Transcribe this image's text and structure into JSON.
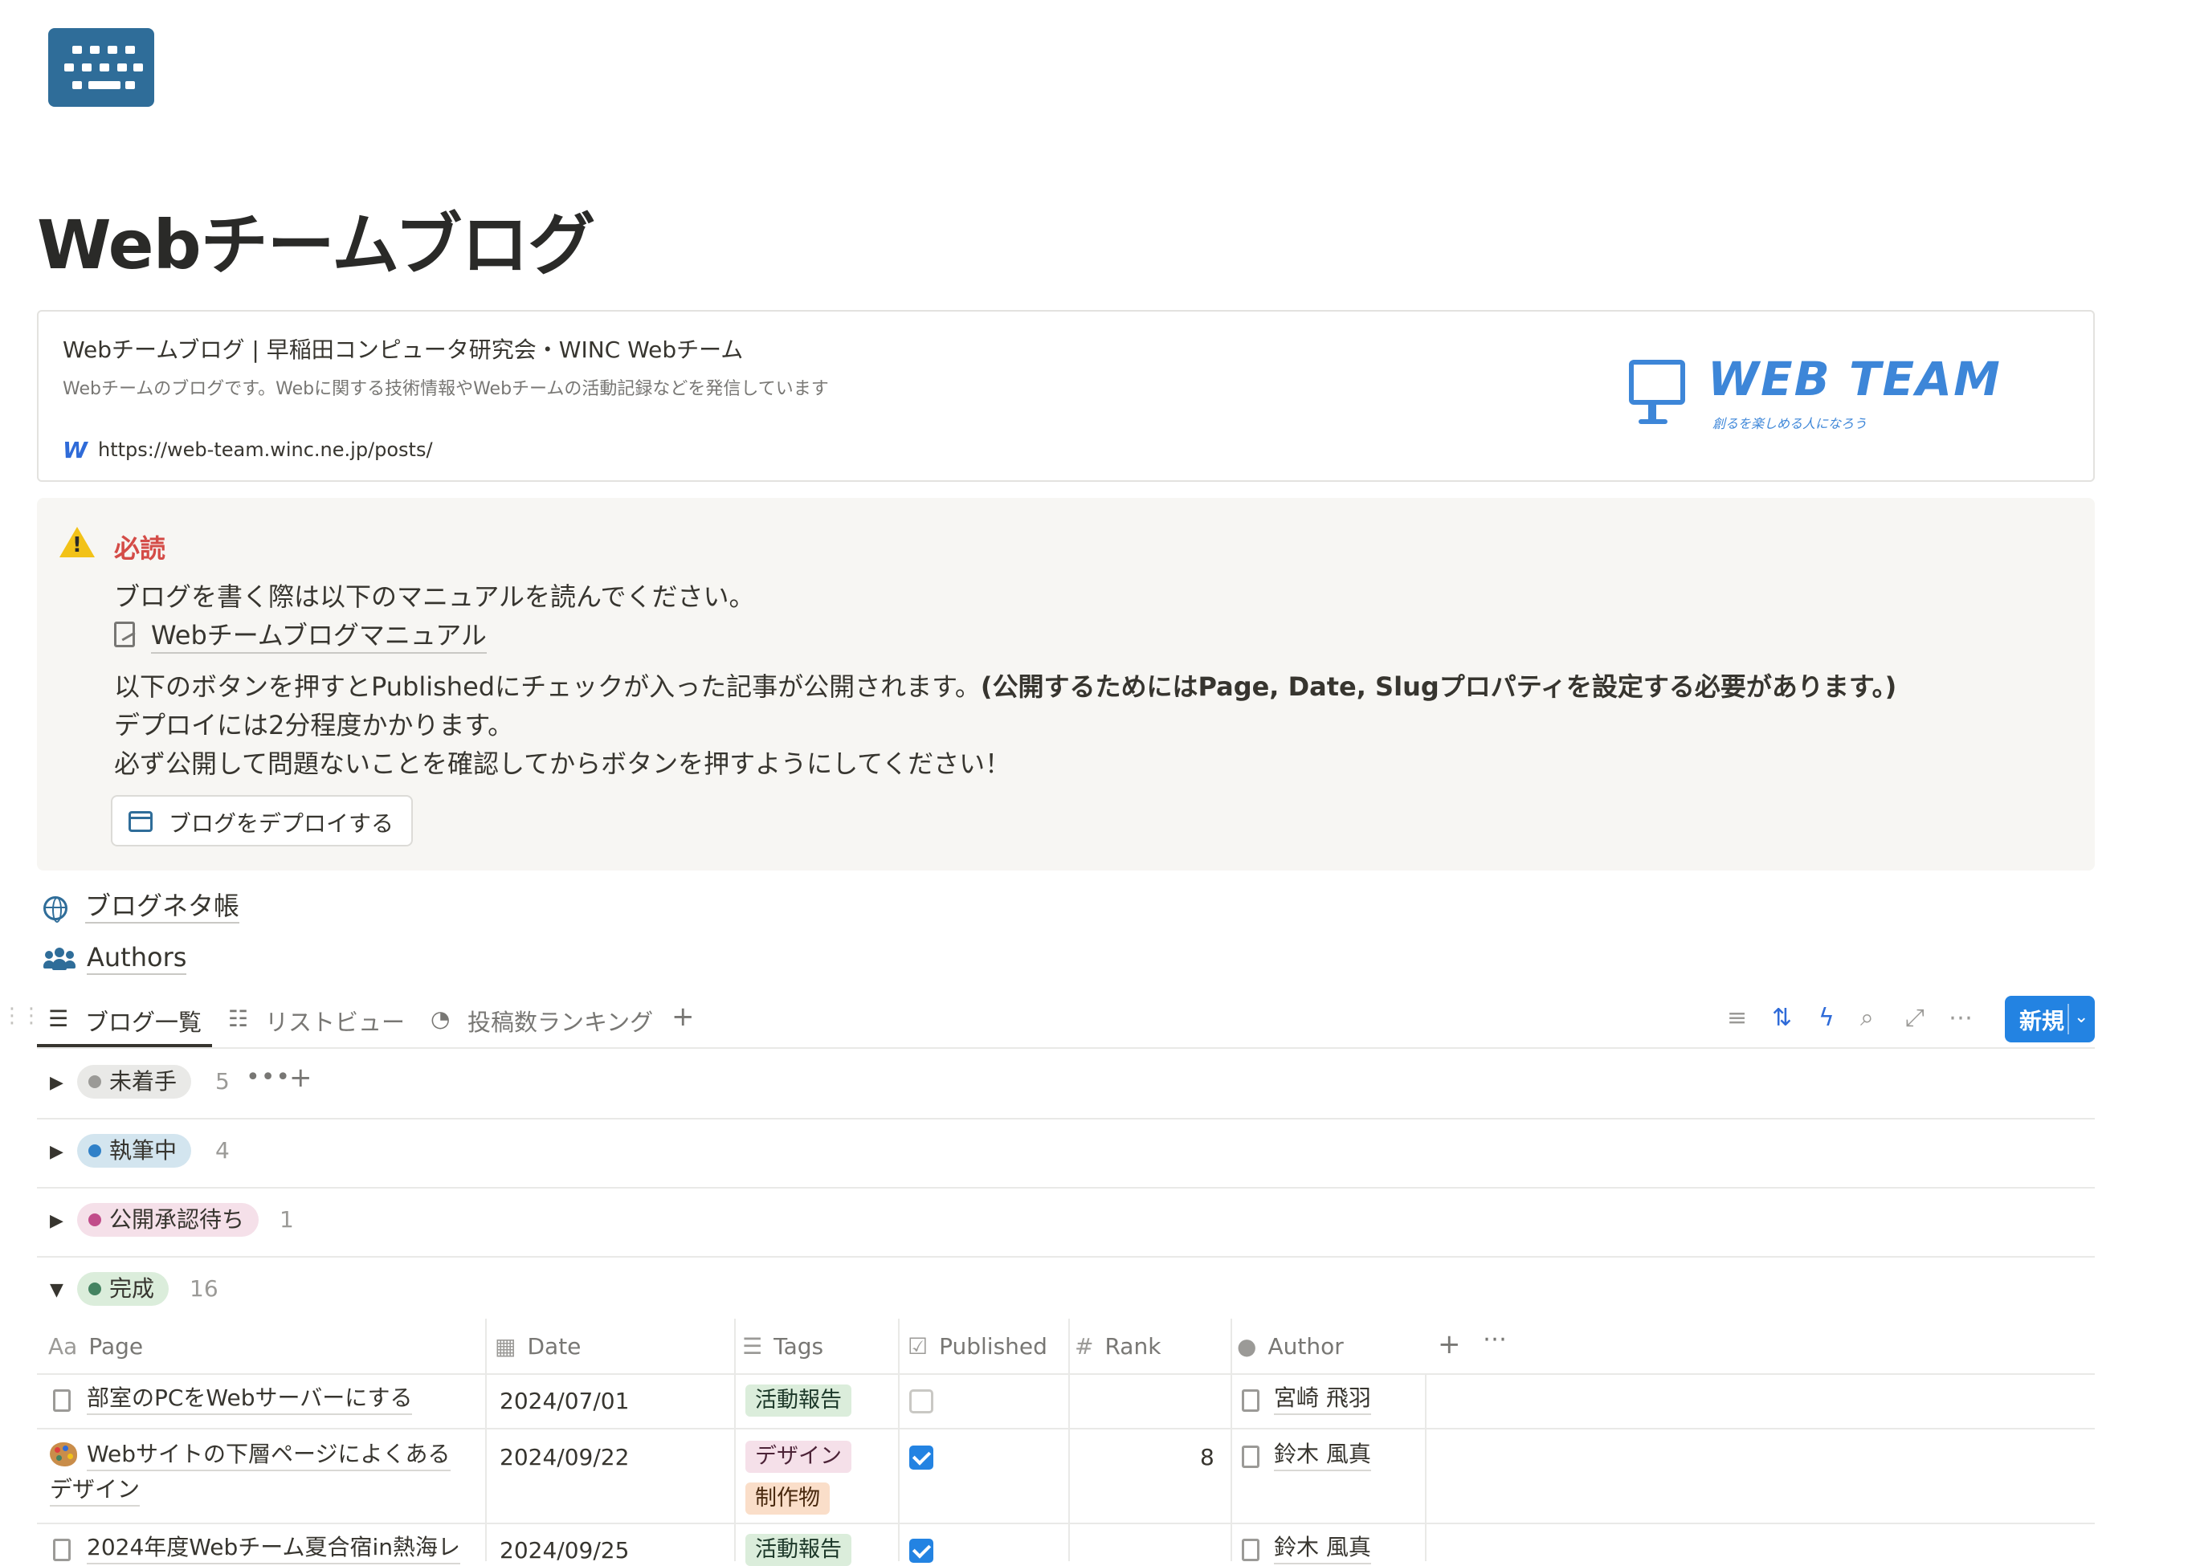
{
  "page": {
    "title": "Webチームブログ"
  },
  "bookmark": {
    "title": "Webチームブログ | 早稲田コンピュータ研究会・WINC Webチーム",
    "description": "Webチームのブログです。Webに関する技術情報やWebチームの活動記録などを発信しています",
    "url": "https://web-team.winc.ne.jp/posts/",
    "logo_text": "WEB TEAM",
    "logo_subtext": "創るを楽しめる人になろう"
  },
  "callout": {
    "title": "必読",
    "line1": "ブログを書く際は以下のマニュアルを読んでください。",
    "manual_link": "Webチームブログマニュアル",
    "line2_normal": "以下のボタンを押すとPublishedにチェックが入った記事が公開されます。",
    "line2_bold": "(公開するためにはPage, Date, Slugプロパティを設定する必要があります。)",
    "line3": "デプロイには2分程度かかります。",
    "line4": "必ず公開して問題ないことを確認してからボタンを押すようにしてください！",
    "button_label": "ブログをデプロイする"
  },
  "links": {
    "ideas": "ブログネタ帳",
    "authors": "Authors"
  },
  "tabs": [
    {
      "label": "ブログ一覧",
      "icon": "list-icon"
    },
    {
      "label": "リストビュー",
      "icon": "bullet-list-icon"
    },
    {
      "label": "投稿数ランキング",
      "icon": "pie-chart-icon"
    }
  ],
  "toolbar": {
    "new_label": "新規"
  },
  "groups": [
    {
      "name": "未着手",
      "count": "5",
      "color": "#9b9a97",
      "bg": "#e9e9e7",
      "expanded": false
    },
    {
      "name": "執筆中",
      "count": "4",
      "color": "#2f80c8",
      "bg": "#d3e5ef",
      "expanded": false
    },
    {
      "name": "公開承認待ち",
      "count": "1",
      "color": "#c14c8a",
      "bg": "#f5e0e9",
      "expanded": false
    },
    {
      "name": "完成",
      "count": "16",
      "color": "#448361",
      "bg": "#dbeddb",
      "expanded": true
    }
  ],
  "table": {
    "headers": {
      "page": "Page",
      "page_icon": "Aa",
      "date": "Date",
      "tags": "Tags",
      "published": "Published",
      "rank": "Rank",
      "author": "Author"
    },
    "rows": [
      {
        "title": "部室のPCをWebサーバーにする",
        "date": "2024/07/01",
        "tags": [
          "活動報告"
        ],
        "published": false,
        "rank": "",
        "author": "宮崎 飛羽"
      },
      {
        "title_line1": "Webサイトの下層ページによくある",
        "title_line2": "デザイン",
        "date": "2024/09/22",
        "tags": [
          "デザイン",
          "制作物"
        ],
        "published": true,
        "rank": "8",
        "author": "鈴木 風真"
      },
      {
        "title": "2024年度Webチーム夏合宿in熱海レ",
        "date": "2024/09/25",
        "tags": [
          "活動報告"
        ],
        "published": true,
        "rank": "",
        "author": "鈴木 風真"
      }
    ]
  },
  "colors": {
    "accent": "#2383e2",
    "tag_report_bg": "#dbeddb",
    "tag_report_fg": "#1c3829",
    "tag_design_bg": "#f5e0e9",
    "tag_design_fg": "#4c2337",
    "tag_product_bg": "#fadec9",
    "tag_product_fg": "#49290e"
  }
}
